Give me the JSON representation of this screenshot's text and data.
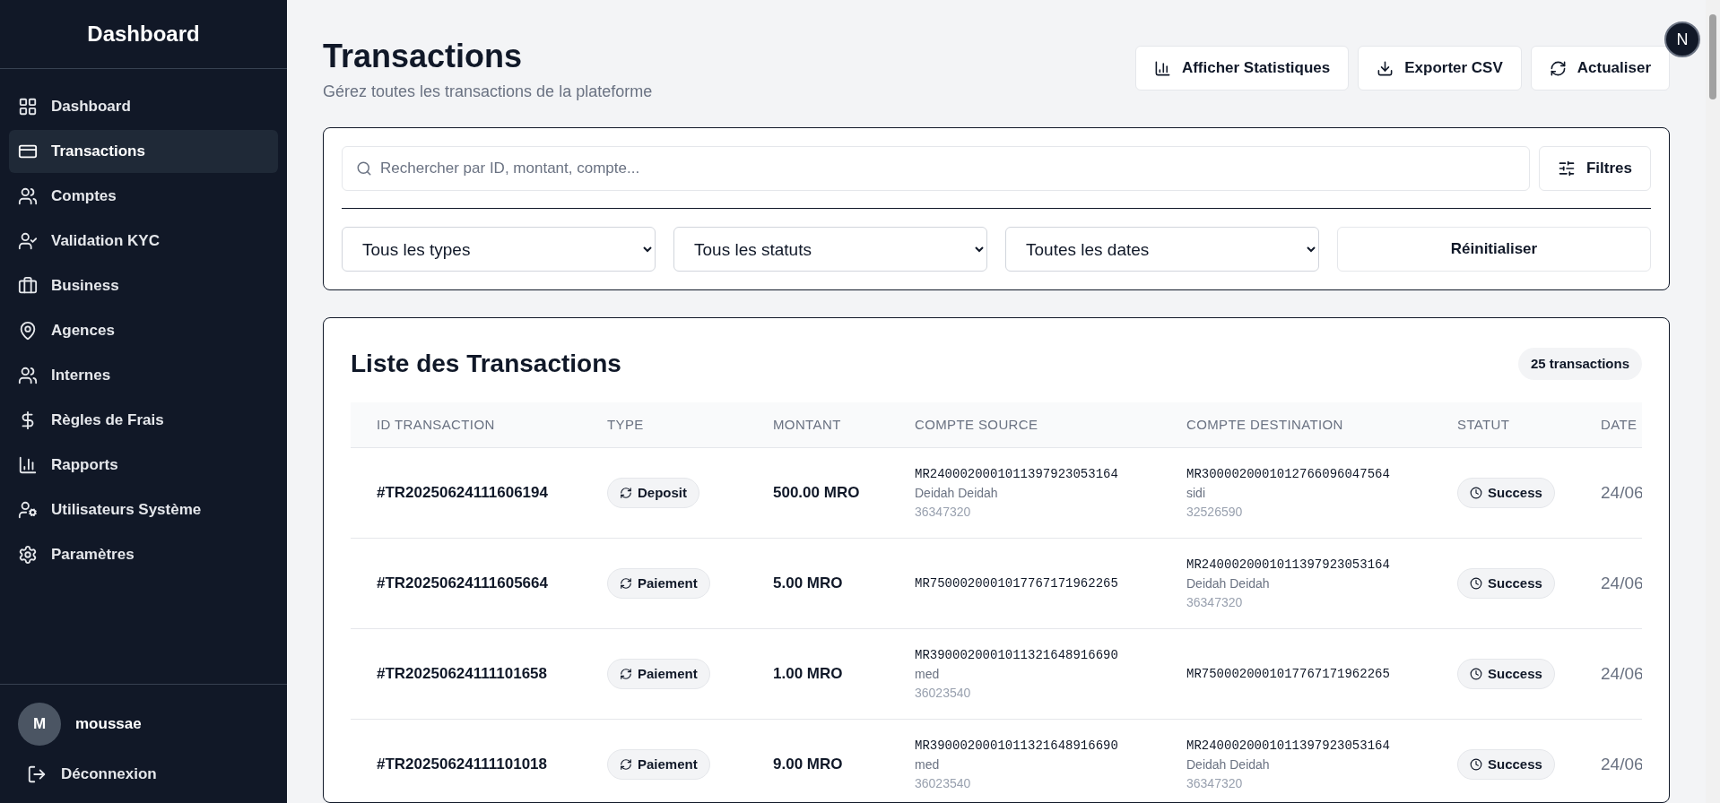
{
  "sidebar": {
    "title": "Dashboard",
    "items": [
      {
        "label": "Dashboard",
        "selected": false
      },
      {
        "label": "Transactions",
        "selected": true
      },
      {
        "label": "Comptes",
        "selected": false
      },
      {
        "label": "Validation KYC",
        "selected": false
      },
      {
        "label": "Business",
        "selected": false
      },
      {
        "label": "Agences",
        "selected": false
      },
      {
        "label": "Internes",
        "selected": false
      },
      {
        "label": "Règles de Frais",
        "selected": false
      },
      {
        "label": "Rapports",
        "selected": false
      },
      {
        "label": "Utilisateurs Système",
        "selected": false
      },
      {
        "label": "Paramètres",
        "selected": false
      }
    ],
    "user": {
      "initial": "M",
      "name": "moussae"
    },
    "logout": "Déconnexion"
  },
  "header": {
    "title": "Transactions",
    "subtitle": "Gérez toutes les transactions de la plateforme",
    "badge": "N",
    "buttons": [
      {
        "label": "Afficher Statistiques"
      },
      {
        "label": "Exporter CSV"
      },
      {
        "label": "Actualiser"
      }
    ]
  },
  "filters": {
    "search": {
      "placeholder": "Rechercher par ID, montant, compte..."
    },
    "filter_button": "Filtres",
    "selects": [
      "Tous les types",
      "Tous les statuts",
      "Toutes les dates"
    ],
    "reset": "Réinitialiser"
  },
  "table": {
    "title": "Liste des Transactions",
    "count": "25 transactions",
    "columns": [
      "ID TRANSACTION",
      "TYPE",
      "MONTANT",
      "COMPTE SOURCE",
      "COMPTE DESTINATION",
      "STATUT",
      "DATE"
    ],
    "rows": [
      {
        "id": "#TR20250624111606194",
        "type": "Deposit",
        "amount": "500.00 MRO",
        "source": {
          "account": "MR2400020001011397923053164",
          "name": "Deidah Deidah",
          "phone": "36347320"
        },
        "destination": {
          "account": "MR3000020001012766096047564",
          "name": "sidi",
          "phone": "32526590"
        },
        "status": "Success",
        "date": "24/06"
      },
      {
        "id": "#TR20250624111605664",
        "type": "Paiement",
        "amount": "5.00 MRO",
        "source": {
          "account": "MR7500020001017767171962265"
        },
        "destination": {
          "account": "MR2400020001011397923053164",
          "name": "Deidah Deidah",
          "phone": "36347320"
        },
        "status": "Success",
        "date": "24/06"
      },
      {
        "id": "#TR20250624111101658",
        "type": "Paiement",
        "amount": "1.00 MRO",
        "source": {
          "account": "MR3900020001011321648916690",
          "name": "med",
          "phone": "36023540"
        },
        "destination": {
          "account": "MR7500020001017767171962265"
        },
        "status": "Success",
        "date": "24/06"
      },
      {
        "id": "#TR20250624111101018",
        "type": "Paiement",
        "amount": "9.00 MRO",
        "source": {
          "account": "MR3900020001011321648916690",
          "name": "med",
          "phone": "36023540"
        },
        "destination": {
          "account": "MR2400020001011397923053164",
          "name": "Deidah Deidah",
          "phone": "36347320"
        },
        "status": "Success",
        "date": "24/06"
      }
    ]
  }
}
